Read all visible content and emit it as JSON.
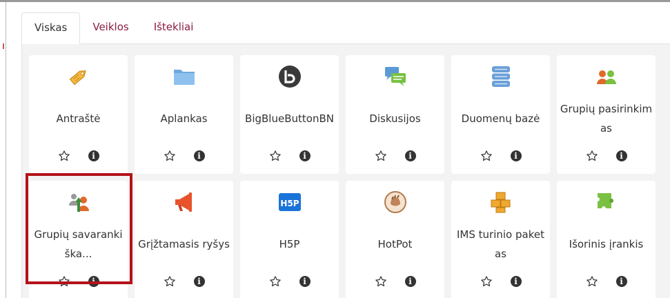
{
  "tabs": [
    "Viskas",
    "Veiklos",
    "Ištekliai"
  ],
  "modules": [
    {
      "label": "Antraštė",
      "icon": "label-tag-icon"
    },
    {
      "label": "Aplankas",
      "icon": "folder-icon"
    },
    {
      "label": "BigBlueButtonBN",
      "icon": "bigbluebutton-icon"
    },
    {
      "label": "Diskusijos",
      "icon": "forum-icon"
    },
    {
      "label": "Duomenų bazė",
      "icon": "database-icon"
    },
    {
      "label": "Grupių pasirinkimas",
      "icon": "group-choice-icon"
    },
    {
      "label": "Grupių savarankiška...",
      "icon": "group-selfselection-icon"
    },
    {
      "label": "Grįžtamasis ryšys",
      "icon": "feedback-megaphone-icon"
    },
    {
      "label": "H5P",
      "icon": "h5p-icon"
    },
    {
      "label": "HotPot",
      "icon": "hotpot-icon"
    },
    {
      "label": "IMS turinio paketas",
      "icon": "ims-package-icon"
    },
    {
      "label": "Išorinis įrankis",
      "icon": "external-tool-icon"
    }
  ],
  "actions": {
    "star": "star-icon",
    "info_glyph": "i"
  }
}
